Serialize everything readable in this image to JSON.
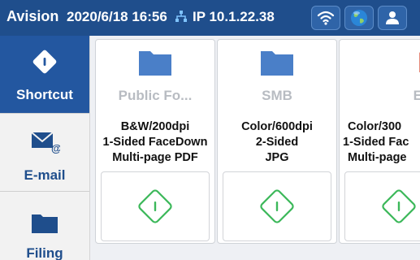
{
  "status_bar": {
    "brand": "Avision",
    "datetime": "2020/6/18 16:56",
    "ip": "IP 10.1.22.38",
    "icons": [
      "network-icon",
      "wifi-icon",
      "globe-icon",
      "user-icon"
    ]
  },
  "sidebar": {
    "items": [
      {
        "label": "Shortcut",
        "icon": "shortcut-diamond-icon",
        "active": true
      },
      {
        "label": "E-mail",
        "icon": "email-icon",
        "active": false
      },
      {
        "label": "Filing",
        "icon": "folder-icon",
        "active": false
      }
    ]
  },
  "cards": [
    {
      "name": "Public Fo...",
      "icon": "folder-icon",
      "line1": "B&W/200dpi",
      "line2": "1-Sided FaceDown",
      "line3": "Multi-page PDF"
    },
    {
      "name": "SMB",
      "icon": "folder-icon",
      "line1": "Color/600dpi",
      "line2": "2-Sided",
      "line3": "JPG"
    },
    {
      "name": "Email",
      "icon": "email-icon",
      "line1": "Color/300",
      "line2": "1-Sided Fac",
      "line3": "Multi-page"
    }
  ],
  "colors": {
    "top_bar": "#1f4e8c",
    "sidebar_active": "#2357a0",
    "folder_icon": "#4a7fc8",
    "email_icon": "#e58a7a",
    "start_icon": "#3cb85a"
  }
}
